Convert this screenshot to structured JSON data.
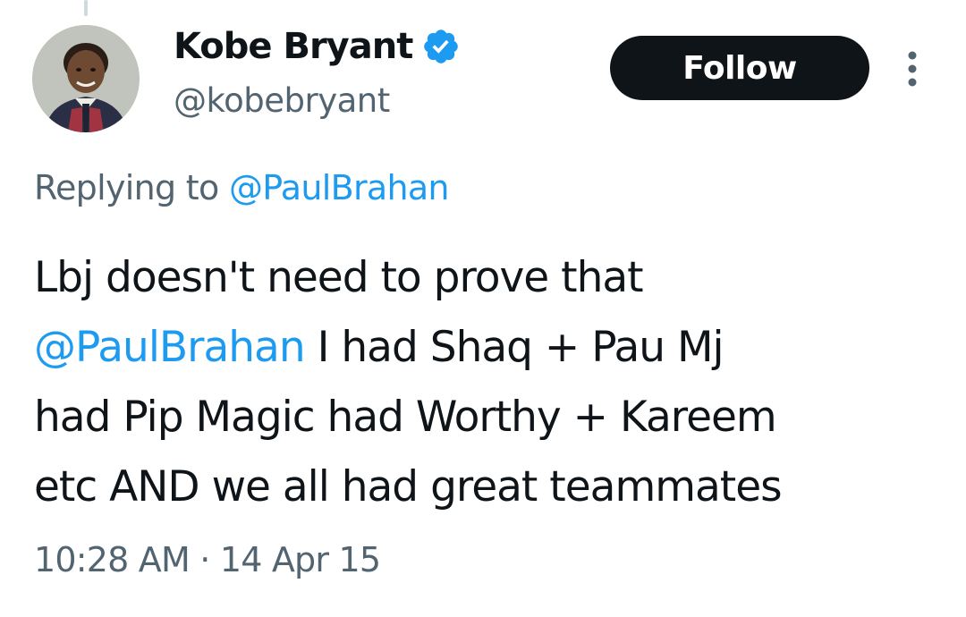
{
  "tweet": {
    "author": {
      "display_name": "Kobe Bryant",
      "handle": "@kobebryant",
      "verified": true,
      "verified_icon": "verified-badge-icon",
      "avatar": "child-portrait-avatar"
    },
    "follow_label": "Follow",
    "more_icon": "more-vertical-icon",
    "replying_prefix": "Replying to",
    "replying_to": "@PaulBrahan",
    "text": {
      "line1": "Lbj doesn't need to prove that",
      "mention": "@PaulBrahan",
      "line2_rest": " I had Shaq + Pau Mj",
      "line3": "had Pip Magic had Worthy + Kareem",
      "line4": "etc AND we all had great teammates"
    },
    "time": "10:28 AM",
    "separator": "·",
    "date": "14 Apr 15"
  },
  "colors": {
    "primary_text": "#0f1419",
    "secondary_text": "#536471",
    "link": "#1d9bf0",
    "follow_bg": "#0f1419",
    "follow_text": "#ffffff",
    "verified": "#1d9bf0"
  }
}
